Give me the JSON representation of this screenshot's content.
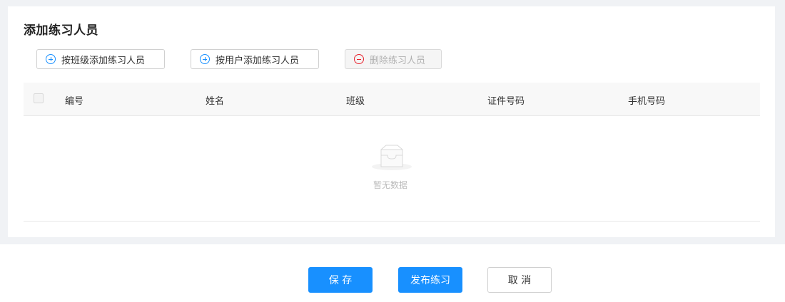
{
  "section": {
    "title": "添加练习人员"
  },
  "toolbar": {
    "add_by_class_label": "按班级添加练习人员",
    "add_by_user_label": "按用户添加练习人员",
    "delete_label": "删除练习人员"
  },
  "table": {
    "columns": [
      "编号",
      "姓名",
      "班级",
      "证件号码",
      "手机号码"
    ],
    "rows": [],
    "empty_text": "暂无数据"
  },
  "footer": {
    "save_label": "保 存",
    "publish_label": "发布练习",
    "cancel_label": "取 消"
  },
  "colors": {
    "primary": "#1890ff",
    "danger": "#e8212c",
    "page_bg": "#f0f2f5"
  },
  "icons": {
    "add": "plus-circle-icon",
    "delete": "minus-circle-icon",
    "empty": "empty-inbox-icon"
  }
}
